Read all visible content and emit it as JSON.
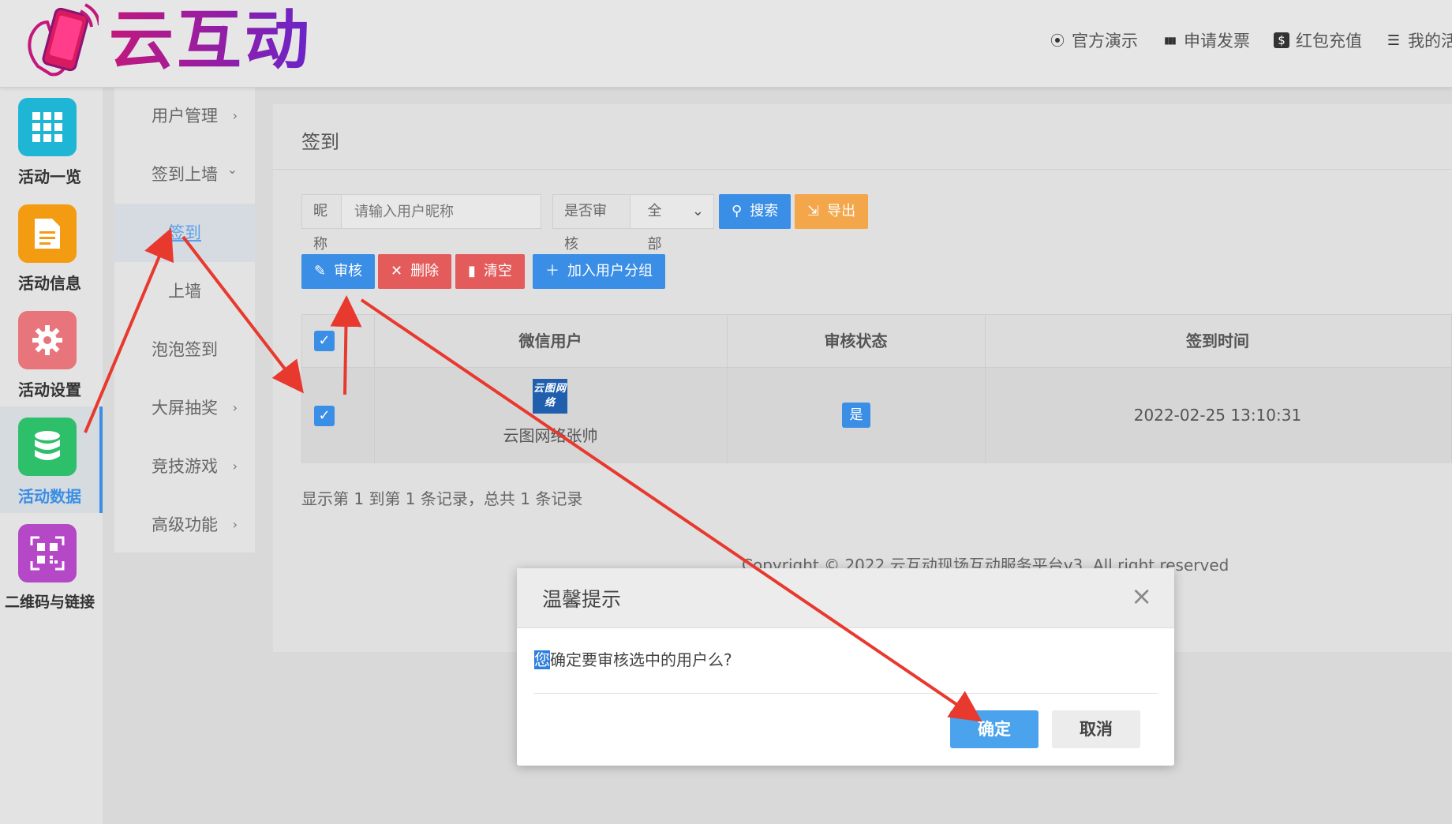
{
  "brand": {
    "name": "云互动"
  },
  "topnav": [
    {
      "label": "官方演示",
      "icon": "play-circle-icon",
      "glyph": "⦿"
    },
    {
      "label": "申请发票",
      "icon": "barcode-icon",
      "glyph": "▮▮▮"
    },
    {
      "label": "红包充值",
      "icon": "dollar-icon",
      "glyph": "$"
    },
    {
      "label": "我的活",
      "icon": "list-icon",
      "glyph": "☰"
    }
  ],
  "iconbar": [
    {
      "label": "活动一览",
      "icon": "grid-icon",
      "color": "#1fb6d6"
    },
    {
      "label": "活动信息",
      "icon": "document-icon",
      "color": "#f39c12"
    },
    {
      "label": "活动设置",
      "icon": "gear-icon",
      "color": "#e8747c"
    },
    {
      "label": "活动数据",
      "icon": "database-icon",
      "color": "#2dbf6a"
    },
    {
      "label": "二维码与链接",
      "icon": "qrcode-icon",
      "color": "#b548c6"
    }
  ],
  "submenu": [
    {
      "label": "用户管理",
      "arrow": "›"
    },
    {
      "label": "签到上墙",
      "arrow": "⌄"
    },
    {
      "label": "签到",
      "arrow": ""
    },
    {
      "label": "上墙",
      "arrow": ""
    },
    {
      "label": "泡泡签到",
      "arrow": ""
    },
    {
      "label": "大屏抽奖",
      "arrow": "›"
    },
    {
      "label": "竞技游戏",
      "arrow": "›"
    },
    {
      "label": "高级功能",
      "arrow": "›"
    }
  ],
  "panel": {
    "title": "签到"
  },
  "filters": {
    "nickname_label": "昵称",
    "nickname_placeholder": "请输入用户昵称",
    "audit_label": "是否审核",
    "audit_value": "全部",
    "search_label": "搜索",
    "export_label": "导出"
  },
  "actions": {
    "audit_label": "审核",
    "delete_label": "删除",
    "clear_label": "清空",
    "add_group_label": "加入用户分组"
  },
  "table": {
    "columns": [
      "微信用户",
      "审核状态",
      "签到时间"
    ],
    "rows": [
      {
        "avatar_text": "云图网络",
        "user": "云图网络张帅",
        "status": "是",
        "time": "2022-02-25 13:10:31"
      }
    ]
  },
  "pagination": {
    "info": "显示第 1 到第 1 条记录，总共 1 条记录"
  },
  "footer": {
    "copyright": "Copyright © 2022 云互动现场互动服务平台v3. All right reserved"
  },
  "dialog": {
    "title": "温馨提示",
    "close": "×",
    "message_highlight": "您",
    "message_rest": "确定要审核选中的用户么?",
    "ok_label": "确定",
    "cancel_label": "取消"
  },
  "colors": {
    "primary": "#3a8ee6",
    "danger": "#e45b5b",
    "warning": "#f3a64a",
    "annotation": "#e8392f"
  }
}
